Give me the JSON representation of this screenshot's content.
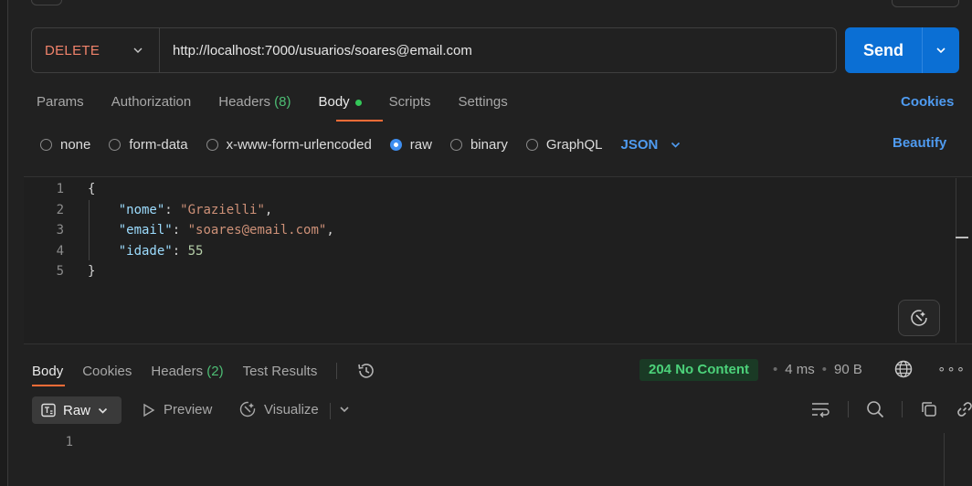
{
  "request": {
    "method": "DELETE",
    "url": "http://localhost:7000/usuarios/soares@email.com",
    "send_label": "Send"
  },
  "request_tabs": {
    "params": "Params",
    "authorization": "Authorization",
    "headers": "Headers",
    "headers_count": "(8)",
    "body": "Body",
    "scripts": "Scripts",
    "settings": "Settings",
    "cookies": "Cookies"
  },
  "body_types": {
    "none": "none",
    "form_data": "form-data",
    "urlencoded": "x-www-form-urlencoded",
    "raw": "raw",
    "binary": "binary",
    "graphql": "GraphQL",
    "selected": "raw",
    "language": "JSON",
    "beautify": "Beautify"
  },
  "editor": {
    "line_numbers": [
      "1",
      "2",
      "3",
      "4",
      "5"
    ],
    "open_brace": "{",
    "close_brace": "}",
    "fields": [
      {
        "key": "\"nome\"",
        "value": "\"Grazielli\"",
        "trail": ","
      },
      {
        "key": "\"email\"",
        "value": "\"soares@email.com\"",
        "trail": ","
      },
      {
        "key": "\"idade\"",
        "value": "55",
        "trail": ""
      }
    ]
  },
  "response_tabs": {
    "body": "Body",
    "cookies": "Cookies",
    "headers": "Headers",
    "headers_count": "(2)",
    "test_results": "Test Results"
  },
  "response_meta": {
    "status": "204 No Content",
    "time": "4 ms",
    "size": "90 B",
    "more": "∘∘∘"
  },
  "response_view": {
    "raw": "Raw",
    "preview": "Preview",
    "visualize": "Visualize",
    "line_numbers": [
      "1"
    ]
  },
  "colors": {
    "accent_orange": "#ff6c37",
    "send_blue": "#0b6fd4",
    "link_blue": "#4f9bf0",
    "status_green": "#4cd27a",
    "method_delete": "#f1836b"
  }
}
